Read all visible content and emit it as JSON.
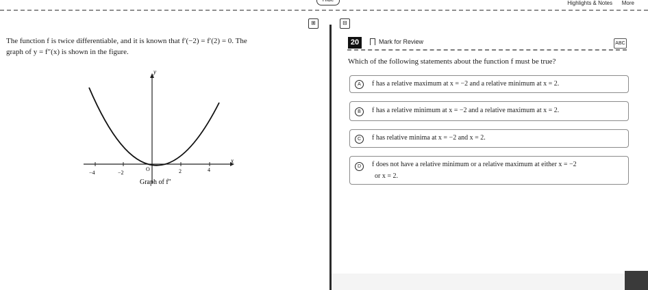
{
  "topbar": {
    "hide_label": "Hide",
    "highlights_label": "Highlights & Notes",
    "more_label": "More"
  },
  "tools": {
    "calc_icon": "calculator-icon",
    "ref_icon": "reference-icon"
  },
  "stem": {
    "line1": "The function f is twice differentiable, and it is known that f′(−2) = f′(2) = 0. The",
    "line2": "graph of y = f″(x) is shown in the figure."
  },
  "graph": {
    "ylabel": "y",
    "xlabel": "x",
    "caption": "Graph of f″",
    "ticks": [
      "−4",
      "−2",
      "O",
      "2",
      "4"
    ]
  },
  "question": {
    "number": "20",
    "mark_label": "Mark for Review",
    "abc_label": "ABC",
    "prompt": "Which of the following statements about the function f must be true?",
    "choices": [
      {
        "letter": "A",
        "text": "f has a relative maximum at x = −2 and a relative minimum at x = 2."
      },
      {
        "letter": "B",
        "text": "f has a relative minimum at x = −2 and a relative maximum at x = 2."
      },
      {
        "letter": "C",
        "text": "f has relative minima at x = −2 and x = 2."
      },
      {
        "letter": "D",
        "text": "f does not have a relative minimum or a relative maximum at either x = −2",
        "text2": "or x = 2."
      }
    ]
  }
}
